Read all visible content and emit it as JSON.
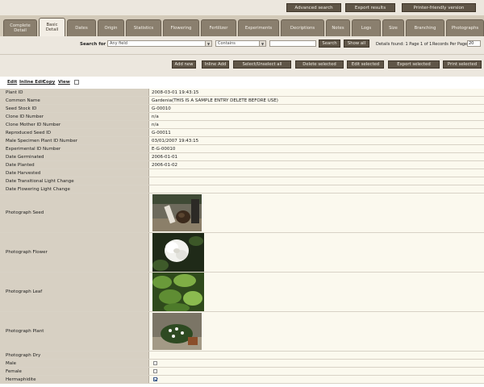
{
  "toolbar": {
    "advanced_search": "Advanced search",
    "export_results": "Export results",
    "printer_friendly": "Printer-friendly version"
  },
  "tabs": [
    "Complete\nDetail",
    "Basic\nDetail",
    "Dates",
    "Origin",
    "Statistics",
    "Flowering",
    "Fertilizer",
    "Experiments",
    "Decriptions",
    "Notes",
    "Logs",
    "Size",
    "Branching",
    "Photographs"
  ],
  "active_tab_index": 1,
  "search": {
    "label": "Search for",
    "field_value": "Any field",
    "operator_value": "Contains",
    "query_value": "",
    "search_button": "Search",
    "show_all_button": "Show all",
    "details_found": "Details found: 1 Page 1 of 1",
    "records_per_page_label": "Records Per Page:",
    "records_per_page_value": "20"
  },
  "actions": {
    "add_new": "Add new",
    "inline_add": "Inline Add",
    "select_unselect_all": "Select/Unselect all",
    "delete_selected": "Delete selected",
    "edit_selected": "Edit selected",
    "export_selected": "Export selected",
    "print_selected": "Print selected"
  },
  "record_links": {
    "edit": "Edit",
    "inline_edit": "Inline Edit",
    "copy": "Copy",
    "view": "View"
  },
  "fields": [
    {
      "label": "Plant ID",
      "value": "2008-03-01 19:43:15"
    },
    {
      "label": "Common Name",
      "value": "Gardenia(THIS IS A SAMPLE ENTRY DELETE BEFORE USE)"
    },
    {
      "label": "Seed Stock ID",
      "value": "G-00010"
    },
    {
      "label": "Clone ID Number",
      "value": "n/a"
    },
    {
      "label": "Clone Mother ID Number",
      "value": "n/a"
    },
    {
      "label": "Reproduced Seed ID",
      "value": "G-00011"
    },
    {
      "label": "Male Specimen Plant ID Number",
      "value": "03/01/2007 19:43:15"
    },
    {
      "label": "Experimental ID Number",
      "value": "E-G-00010"
    },
    {
      "label": "Date Germinated",
      "value": "2006-01-01"
    },
    {
      "label": "Date Planted",
      "value": "2006-01-02"
    },
    {
      "label": "Date Harvested",
      "value": ""
    },
    {
      "label": "Date Transitional Light Change",
      "value": ""
    },
    {
      "label": "Date Flowering Light Change",
      "value": ""
    },
    {
      "label": "Photograph Seed",
      "value": ""
    },
    {
      "label": "Photograph Flower",
      "value": ""
    },
    {
      "label": "Photograph Leaf",
      "value": ""
    },
    {
      "label": "Photograph Plant",
      "value": ""
    },
    {
      "label": "Photograph Dry",
      "value": ""
    },
    {
      "label": "Male",
      "value": ""
    },
    {
      "label": "Female",
      "value": ""
    },
    {
      "label": "Hermaphidite",
      "value": ""
    }
  ],
  "flags": {
    "male": false,
    "female": false,
    "hermaphidite": true
  },
  "colors": {
    "button_bg": "#5f5547",
    "tab_bg": "#8a7f6e",
    "label_col": "#d7d0c3",
    "value_col": "#fbf9ee"
  },
  "icons": {
    "dropdown": "chevron-down-icon"
  }
}
